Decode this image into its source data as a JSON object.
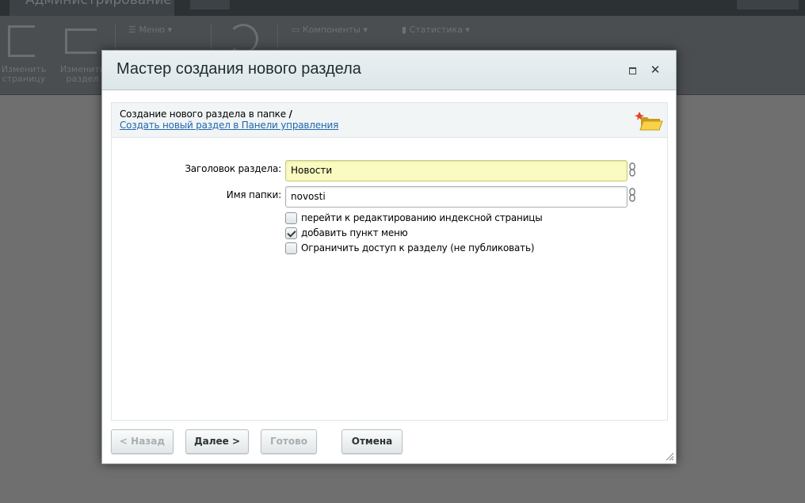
{
  "background": {
    "tab_title": "Администрирование",
    "toolbar": {
      "edit_page_line1": "Изменить",
      "edit_page_line2": "страницу",
      "edit_section_line1": "Изменить",
      "edit_section_line2": "раздел",
      "menu_label": "Меню",
      "components_label": "Компоненты",
      "statistics_label": "Статистика"
    }
  },
  "dialog": {
    "title": "Мастер создания нового раздела",
    "info": {
      "text_prefix": "Создание нового раздела в папке ",
      "folder_path": "/",
      "link_text": "Создать новый раздел в Панели управления"
    },
    "form": {
      "section_title_label": "Заголовок раздела:",
      "section_title_value": "Новости",
      "folder_name_label": "Имя папки:",
      "folder_name_value": "novosti",
      "checkboxes": [
        {
          "label": "перейти к редактированию индексной страницы",
          "checked": false
        },
        {
          "label": "добавить пункт меню",
          "checked": true
        },
        {
          "label": "Ограничить доступ к разделу (не публиковать)",
          "checked": false
        }
      ]
    },
    "buttons": {
      "back": "< Назад",
      "next": "Далее >",
      "finish": "Готово",
      "cancel": "Отмена"
    }
  },
  "colors": {
    "link": "#2066b0",
    "highlight_input": "#f9fbc0",
    "header_bg": "#dde6e9",
    "overlay": "#6f6f6f"
  },
  "icons": {
    "maximize": "maximize-icon",
    "close": "close-icon",
    "new_folder": "new-folder-icon",
    "chain_link": "link-icon",
    "resize": "resize-grip-icon"
  }
}
